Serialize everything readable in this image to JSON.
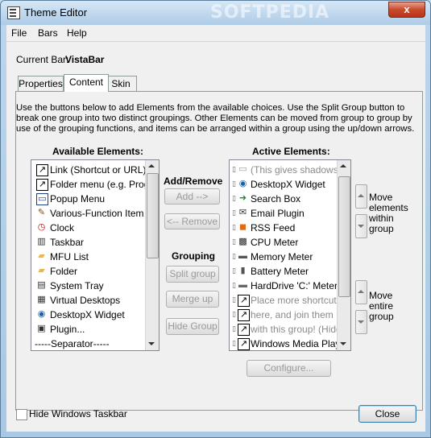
{
  "window": {
    "title": "Theme Editor",
    "watermark": "SOFTPEDIA",
    "close_glyph": "x"
  },
  "menu": [
    "File",
    "Bars",
    "Help"
  ],
  "current_bar": {
    "label": "Current Bar:",
    "value": "VistaBar"
  },
  "tabs": [
    {
      "label": "Properties",
      "active": false
    },
    {
      "label": "Content",
      "active": true
    },
    {
      "label": "Skin",
      "active": false
    }
  ],
  "description": "Use the buttons below to add Elements from the available choices. Use the Split Group button to break one group into two distinct groupings. Other Elements can be moved from group to group by use of the grouping functions, and items can be arranged within a group using the up/down arrows.",
  "available": {
    "heading": "Available Elements:",
    "items": [
      {
        "label": "Link (Shortcut or URL)",
        "icon": "shortcut-icon"
      },
      {
        "label": "Folder menu (e.g. Program",
        "icon": "shortcut-icon"
      },
      {
        "label": "Popup Menu",
        "icon": "popup-menu-icon"
      },
      {
        "label": "Various-Function Item",
        "icon": "tools-icon"
      },
      {
        "label": "Clock",
        "icon": "clock-icon"
      },
      {
        "label": "Taskbar",
        "icon": "taskbar-icon"
      },
      {
        "label": "MFU List",
        "icon": "folder-icon"
      },
      {
        "label": "Folder",
        "icon": "folder-icon"
      },
      {
        "label": "System Tray",
        "icon": "tray-icon"
      },
      {
        "label": "Virtual Desktops",
        "icon": "desktops-icon"
      },
      {
        "label": "DesktopX Widget",
        "icon": "globe-icon"
      },
      {
        "label": "Plugin...",
        "icon": "plugin-icon"
      },
      {
        "label": "-----Separator-----",
        "icon": ""
      }
    ]
  },
  "add_remove": {
    "heading": "Add/Remove",
    "add_label": "Add -->",
    "remove_label": "<-- Remove"
  },
  "grouping": {
    "heading": "Grouping",
    "split_label": "Split group",
    "merge_label": "Merge up",
    "hide_label": "Hide Group"
  },
  "active": {
    "heading": "Active Elements:",
    "items": [
      {
        "label": "(This gives shadows to",
        "icon": "shadow-icon",
        "muted": true
      },
      {
        "label": "DesktopX Widget",
        "icon": "globe-icon",
        "muted": false
      },
      {
        "label": "Search Box",
        "icon": "search-icon",
        "muted": false
      },
      {
        "label": "Email Plugin",
        "icon": "email-icon",
        "muted": false
      },
      {
        "label": "RSS Feed",
        "icon": "rss-icon",
        "muted": false
      },
      {
        "label": "CPU Meter",
        "icon": "cpu-icon",
        "muted": false
      },
      {
        "label": "Memory Meter",
        "icon": "memory-icon",
        "muted": false
      },
      {
        "label": "Battery Meter",
        "icon": "battery-icon",
        "muted": false
      },
      {
        "label": "HardDrive 'C:' Meter",
        "icon": "harddrive-icon",
        "muted": false
      },
      {
        "label": "Place more shortcuts (",
        "icon": "shortcut-icon",
        "muted": true
      },
      {
        "label": "here, and join them (Hi",
        "icon": "shortcut-icon",
        "muted": true
      },
      {
        "label": "with this group! (Hidden",
        "icon": "shortcut-icon",
        "muted": true
      },
      {
        "label": "Windows Media Player",
        "icon": "shortcut-icon",
        "muted": false
      }
    ]
  },
  "move_elements_label": "Move\nelements\nwithin\ngroup",
  "move_group_label": "Move\nentire\ngroup",
  "configure_label": "Configure...",
  "hide_taskbar": {
    "label": "Hide Windows Taskbar",
    "checked": false
  },
  "close_label": "Close"
}
